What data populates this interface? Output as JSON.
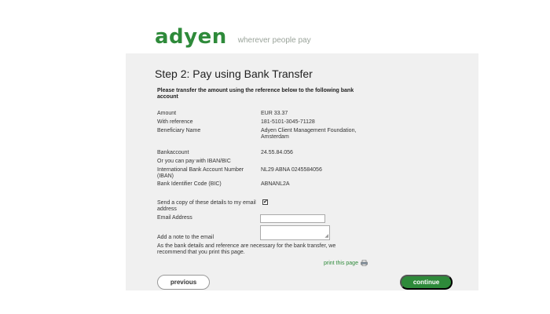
{
  "header": {
    "logo_text": "adyen",
    "tagline": "wherever people pay"
  },
  "step_title": "Step 2: Pay using Bank Transfer",
  "instruction": "Please transfer the amount using the reference below to the following bank account",
  "details": {
    "amount": {
      "label": "Amount",
      "value": "EUR 33.37"
    },
    "reference": {
      "label": "With reference",
      "value": "181-5101-3045-71128"
    },
    "beneficiary": {
      "label": "Beneficiary Name",
      "value": "Adyen Client Management Foundation, Amsterdam"
    },
    "bankaccount": {
      "label": "Bankaccount",
      "value": "24.55.84.056"
    },
    "or_iban": {
      "label": "Or you can pay with IBAN/BIC"
    },
    "iban": {
      "label": "International Bank Account Number (IBAN)",
      "value": "NL29 ABNA 0245584056"
    },
    "bic": {
      "label": "Bank Identifier Code (BIC)",
      "value": "ABNANL2A"
    }
  },
  "email_copy": {
    "label": "Send a copy of these details to my email address",
    "checked": true,
    "check_glyph": "✔"
  },
  "email_address": {
    "label": "Email Address",
    "value": ""
  },
  "note": {
    "label": "Add a note to the email",
    "value": ""
  },
  "print_notice": "As the bank details and reference are necessary for the bank transfer, we recommend that you print this page.",
  "print_link": {
    "label": "print this page",
    "icon": "printer-icon"
  },
  "buttons": {
    "previous": "previous",
    "continue": "continue"
  },
  "colors": {
    "brand_green": "#2e8a3a",
    "panel_bg": "#f0f0f0"
  }
}
